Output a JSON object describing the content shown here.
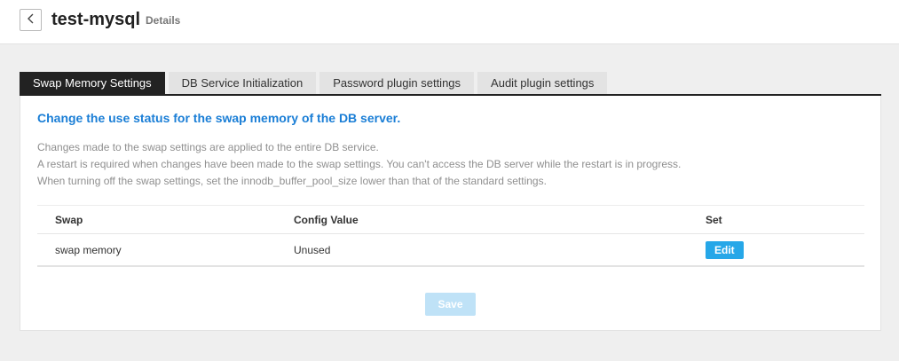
{
  "header": {
    "title": "test-mysql",
    "subtitle": "Details",
    "back_icon": "chevron-left-icon"
  },
  "tabs": [
    {
      "label": "Swap Memory Settings",
      "active": true
    },
    {
      "label": "DB Service Initialization",
      "active": false
    },
    {
      "label": "Password plugin settings",
      "active": false
    },
    {
      "label": "Audit plugin settings",
      "active": false
    }
  ],
  "panel": {
    "heading": "Change the use status for the swap memory of the DB server.",
    "description": [
      "Changes made to the swap settings are applied to the entire DB service.",
      "A restart is required when changes have been made to the swap settings. You can't access the DB server while the restart is in progress.",
      "When turning off the swap settings, set the innodb_buffer_pool_size lower than that of the standard settings."
    ],
    "table": {
      "headers": [
        "Swap",
        "Config Value",
        "Set"
      ],
      "rows": [
        {
          "swap": "swap memory",
          "config_value": "Unused",
          "action_label": "Edit"
        }
      ]
    },
    "save_label": "Save"
  },
  "colors": {
    "accent": "#1a7ed6",
    "edit_button": "#26a7e8",
    "save_button_disabled": "#bfe2f7",
    "active_tab": "#222222"
  }
}
